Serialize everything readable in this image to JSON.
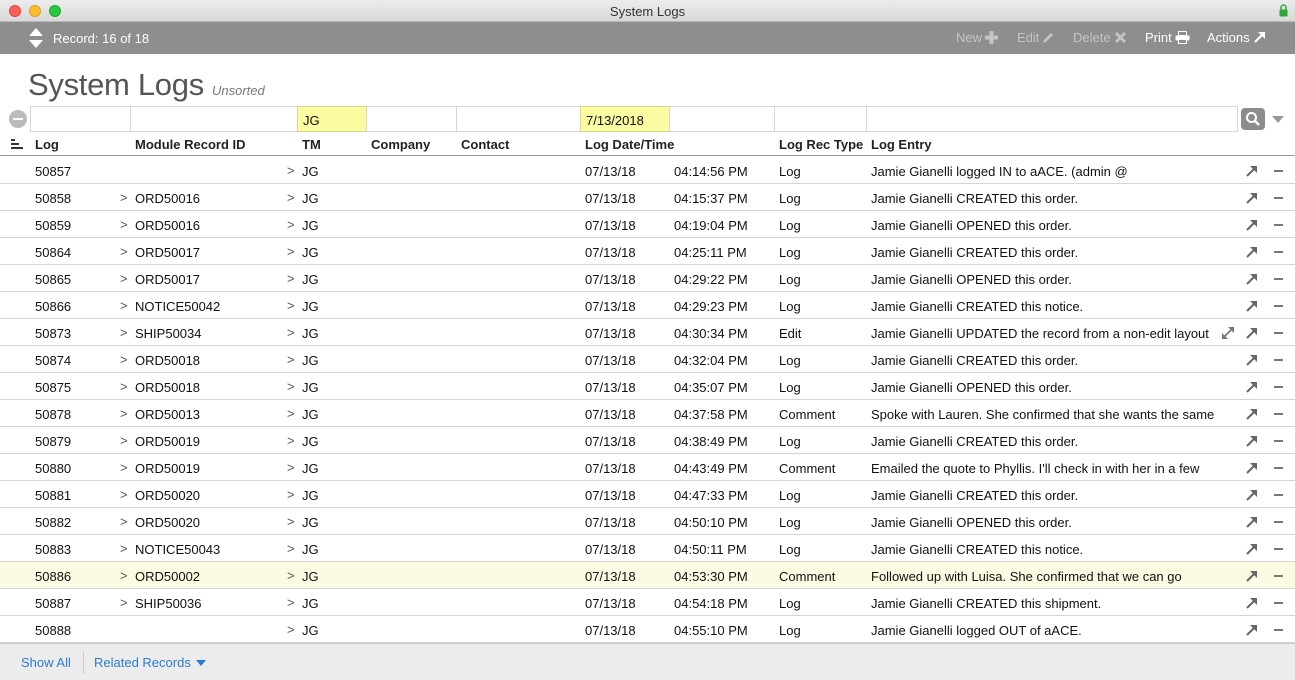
{
  "window": {
    "title": "System Logs"
  },
  "toolbar": {
    "record_label": "Record: 16 of 18",
    "new_label": "New",
    "edit_label": "Edit",
    "delete_label": "Delete",
    "print_label": "Print",
    "actions_label": "Actions"
  },
  "page": {
    "title": "System Logs",
    "sort_state": "Unsorted"
  },
  "find": {
    "log": "",
    "module_record_id": "",
    "tm": "JG",
    "company": "",
    "contact": "",
    "log_date": "7/13/2018",
    "log_time": "",
    "log_rec_type": "",
    "log_entry": ""
  },
  "columns": {
    "log": "Log",
    "module_record_id": "Module Record ID",
    "tm": "TM",
    "company": "Company",
    "contact": "Contact",
    "log_datetime": "Log Date/Time",
    "log_rec_type": "Log Rec Type",
    "log_entry": "Log Entry"
  },
  "rows": [
    {
      "log": "50857",
      "module": "",
      "tm": "JG",
      "date": "07/13/18",
      "time": "04:14:56 PM",
      "type": "Log",
      "entry": "Jamie Gianelli logged IN to aACE. (admin @"
    },
    {
      "log": "50858",
      "module": "ORD50016",
      "tm": "JG",
      "date": "07/13/18",
      "time": "04:15:37 PM",
      "type": "Log",
      "entry": "Jamie Gianelli CREATED this order."
    },
    {
      "log": "50859",
      "module": "ORD50016",
      "tm": "JG",
      "date": "07/13/18",
      "time": "04:19:04 PM",
      "type": "Log",
      "entry": "Jamie Gianelli OPENED this order."
    },
    {
      "log": "50864",
      "module": "ORD50017",
      "tm": "JG",
      "date": "07/13/18",
      "time": "04:25:11 PM",
      "type": "Log",
      "entry": "Jamie Gianelli CREATED this order."
    },
    {
      "log": "50865",
      "module": "ORD50017",
      "tm": "JG",
      "date": "07/13/18",
      "time": "04:29:22 PM",
      "type": "Log",
      "entry": "Jamie Gianelli OPENED this order."
    },
    {
      "log": "50866",
      "module": "NOTICE50042",
      "tm": "JG",
      "date": "07/13/18",
      "time": "04:29:23 PM",
      "type": "Log",
      "entry": "Jamie Gianelli CREATED this notice."
    },
    {
      "log": "50873",
      "module": "SHIP50034",
      "tm": "JG",
      "date": "07/13/18",
      "time": "04:30:34 PM",
      "type": "Edit",
      "entry": "Jamie Gianelli UPDATED the record from a non-edit layout"
    },
    {
      "log": "50874",
      "module": "ORD50018",
      "tm": "JG",
      "date": "07/13/18",
      "time": "04:32:04 PM",
      "type": "Log",
      "entry": "Jamie Gianelli CREATED this order."
    },
    {
      "log": "50875",
      "module": "ORD50018",
      "tm": "JG",
      "date": "07/13/18",
      "time": "04:35:07 PM",
      "type": "Log",
      "entry": "Jamie Gianelli OPENED this order."
    },
    {
      "log": "50878",
      "module": "ORD50013",
      "tm": "JG",
      "date": "07/13/18",
      "time": "04:37:58 PM",
      "type": "Comment",
      "entry": "Spoke with Lauren. She confirmed that she wants the same"
    },
    {
      "log": "50879",
      "module": "ORD50019",
      "tm": "JG",
      "date": "07/13/18",
      "time": "04:38:49 PM",
      "type": "Log",
      "entry": "Jamie Gianelli CREATED this order."
    },
    {
      "log": "50880",
      "module": "ORD50019",
      "tm": "JG",
      "date": "07/13/18",
      "time": "04:43:49 PM",
      "type": "Comment",
      "entry": "Emailed the quote to Phyllis. I'll check in with her in a few"
    },
    {
      "log": "50881",
      "module": "ORD50020",
      "tm": "JG",
      "date": "07/13/18",
      "time": "04:47:33 PM",
      "type": "Log",
      "entry": "Jamie Gianelli CREATED this order."
    },
    {
      "log": "50882",
      "module": "ORD50020",
      "tm": "JG",
      "date": "07/13/18",
      "time": "04:50:10 PM",
      "type": "Log",
      "entry": "Jamie Gianelli OPENED this order."
    },
    {
      "log": "50883",
      "module": "NOTICE50043",
      "tm": "JG",
      "date": "07/13/18",
      "time": "04:50:11 PM",
      "type": "Log",
      "entry": "Jamie Gianelli CREATED this notice."
    },
    {
      "log": "50886",
      "module": "ORD50002",
      "tm": "JG",
      "date": "07/13/18",
      "time": "04:53:30 PM",
      "type": "Comment",
      "entry": "Followed up with Luisa. She confirmed that we can go"
    },
    {
      "log": "50887",
      "module": "SHIP50036",
      "tm": "JG",
      "date": "07/13/18",
      "time": "04:54:18 PM",
      "type": "Log",
      "entry": "Jamie Gianelli CREATED this shipment."
    },
    {
      "log": "50888",
      "module": "",
      "tm": "JG",
      "date": "07/13/18",
      "time": "04:55:10 PM",
      "type": "Log",
      "entry": "Jamie Gianelli logged OUT of aACE."
    }
  ],
  "selected_row": 15,
  "expand_row": 6,
  "footer": {
    "show_all": "Show All",
    "related_records": "Related Records"
  },
  "colors": {
    "highlight": "#fbfba1",
    "link": "#2a7bd0",
    "toolbar": "#8e8e8e",
    "selected_row": "#fbfbe4"
  }
}
